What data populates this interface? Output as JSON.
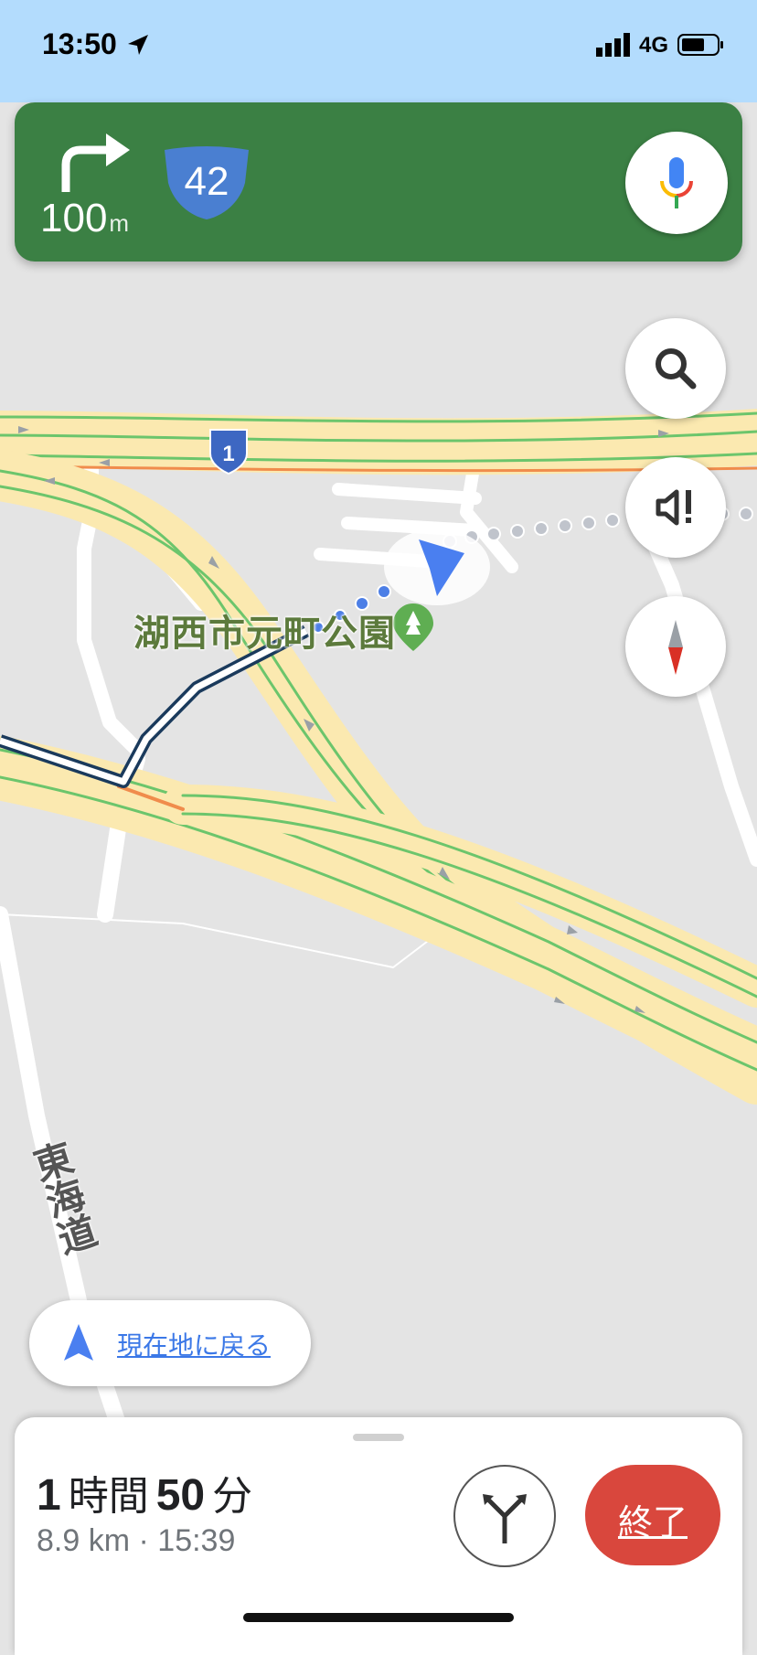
{
  "status_bar": {
    "time": "13:50",
    "network": "4G",
    "icons": [
      "location-arrow-icon",
      "signal-icon",
      "battery-icon"
    ]
  },
  "navigation": {
    "maneuver_icon": "turn-right-icon",
    "distance_value": "100",
    "distance_unit": "m",
    "route_number": "42",
    "mic_icon": "microphone-icon",
    "banner_color": "#3b8044"
  },
  "map": {
    "park_name": "湖西市元町公園",
    "road_name": "東海道",
    "highway_number": "1",
    "route_color": "#1a3a5c",
    "traffic_color": "#6cc56c"
  },
  "map_controls": {
    "search_icon": "search-icon",
    "sound_icon": "sound-alert-icon",
    "compass_icon": "compass-icon"
  },
  "recenter": {
    "label": "現在地に戻る",
    "icon": "navigation-arrow-icon"
  },
  "trip": {
    "hours": "1",
    "hours_unit": "時間",
    "minutes": "50",
    "minutes_unit": "分",
    "distance": "8.9 km",
    "separator": "·",
    "arrival": "15:39",
    "end_label": "終了",
    "alt_routes_icon": "alternate-routes-icon",
    "end_color": "#d9473d"
  }
}
